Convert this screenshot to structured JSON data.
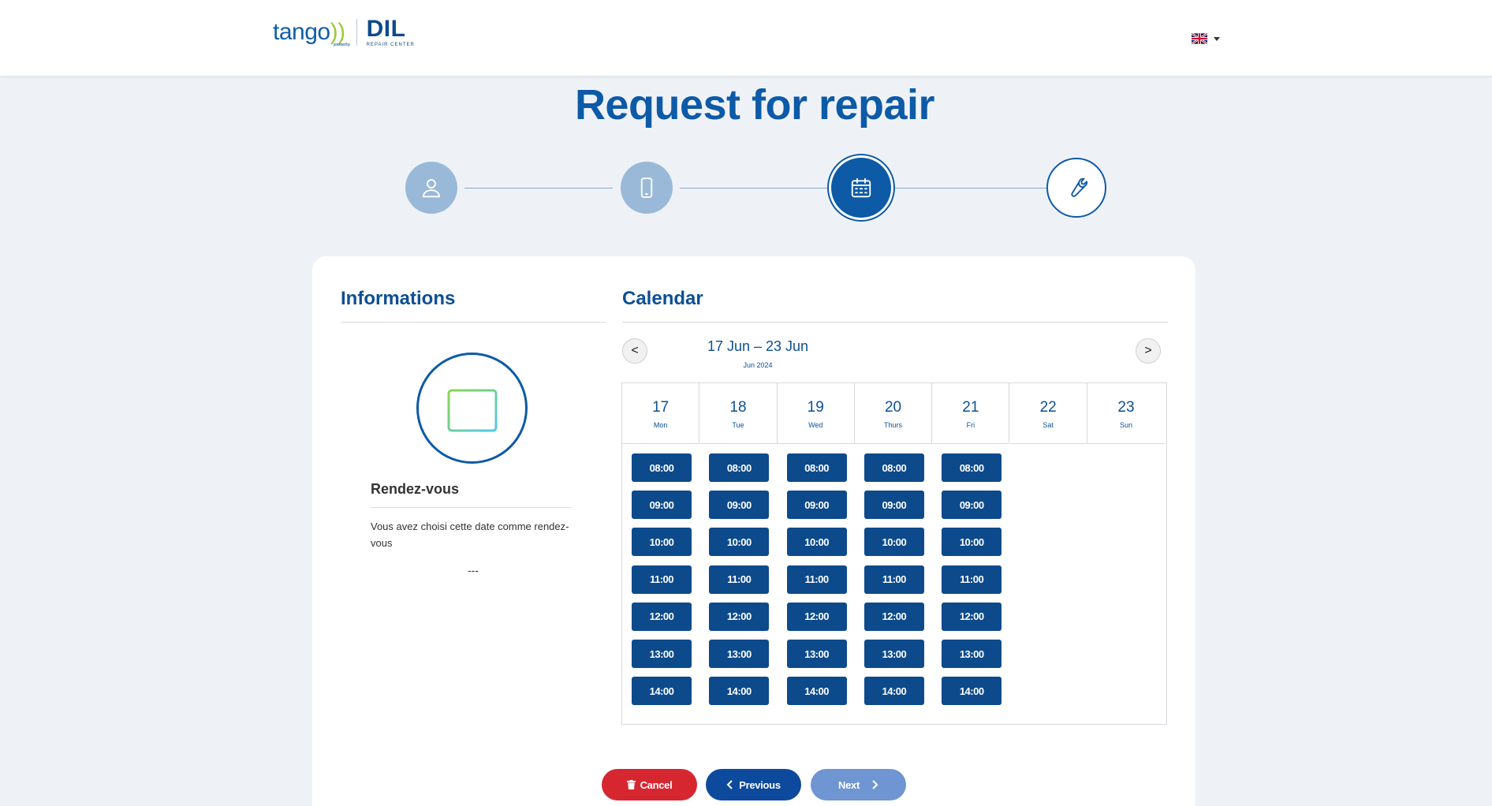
{
  "header": {
    "brand_tango": "tango",
    "brand_tango_suffix": "))",
    "brand_powered": "powered by",
    "brand_dil": "DIL",
    "brand_dil_sub": "REPAIR CENTER",
    "language_icon": "uk-flag-icon"
  },
  "page": {
    "title": "Request for repair"
  },
  "stepper": {
    "steps": [
      {
        "icon": "user-icon",
        "state": "done"
      },
      {
        "icon": "smartphone-icon",
        "state": "done"
      },
      {
        "icon": "calendar-icon",
        "state": "active"
      },
      {
        "icon": "wrench-icon",
        "state": "pending"
      }
    ]
  },
  "informations": {
    "title": "Informations",
    "label": "Rendez-vous",
    "text": "Vous avez choisi cette date comme rendez-vous",
    "value": "---"
  },
  "calendar": {
    "title": "Calendar",
    "prev_label": "<",
    "next_label": ">",
    "week_range": "17 Jun – 23 Jun",
    "month": "Jun 2024",
    "days": [
      {
        "num": "17",
        "name": "Mon",
        "slots": [
          "08:00",
          "09:00",
          "10:00",
          "11:00",
          "12:00",
          "13:00",
          "14:00"
        ]
      },
      {
        "num": "18",
        "name": "Tue",
        "slots": [
          "08:00",
          "09:00",
          "10:00",
          "11:00",
          "12:00",
          "13:00",
          "14:00"
        ]
      },
      {
        "num": "19",
        "name": "Wed",
        "slots": [
          "08:00",
          "09:00",
          "10:00",
          "11:00",
          "12:00",
          "13:00",
          "14:00"
        ]
      },
      {
        "num": "20",
        "name": "Thurs",
        "slots": [
          "08:00",
          "09:00",
          "10:00",
          "11:00",
          "12:00",
          "13:00",
          "14:00"
        ]
      },
      {
        "num": "21",
        "name": "Fri",
        "slots": [
          "08:00",
          "09:00",
          "10:00",
          "11:00",
          "12:00",
          "13:00",
          "14:00"
        ]
      },
      {
        "num": "22",
        "name": "Sat",
        "slots": []
      },
      {
        "num": "23",
        "name": "Sun",
        "slots": []
      }
    ]
  },
  "actions": {
    "cancel_label": "Cancel",
    "previous_label": "Previous",
    "next_label": "Next"
  },
  "colors": {
    "primary": "#0d5aa7",
    "slot": "#0d4a8c",
    "cancel": "#d62731",
    "next_disabled": "#6f95d2",
    "step_done": "#9ab9d9",
    "calendar_icon_gradient": [
      "#4ec9e9",
      "#8cd64a"
    ]
  }
}
